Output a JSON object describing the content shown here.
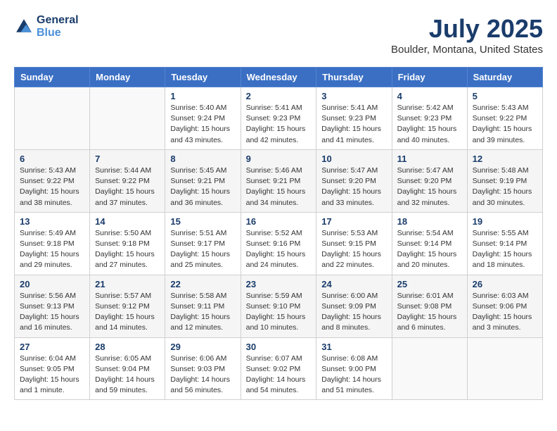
{
  "header": {
    "logo_line1": "General",
    "logo_line2": "Blue",
    "month": "July 2025",
    "location": "Boulder, Montana, United States"
  },
  "weekdays": [
    "Sunday",
    "Monday",
    "Tuesday",
    "Wednesday",
    "Thursday",
    "Friday",
    "Saturday"
  ],
  "weeks": [
    [
      {
        "day": "",
        "sunrise": "",
        "sunset": "",
        "daylight": ""
      },
      {
        "day": "",
        "sunrise": "",
        "sunset": "",
        "daylight": ""
      },
      {
        "day": "1",
        "sunrise": "Sunrise: 5:40 AM",
        "sunset": "Sunset: 9:24 PM",
        "daylight": "Daylight: 15 hours and 43 minutes."
      },
      {
        "day": "2",
        "sunrise": "Sunrise: 5:41 AM",
        "sunset": "Sunset: 9:23 PM",
        "daylight": "Daylight: 15 hours and 42 minutes."
      },
      {
        "day": "3",
        "sunrise": "Sunrise: 5:41 AM",
        "sunset": "Sunset: 9:23 PM",
        "daylight": "Daylight: 15 hours and 41 minutes."
      },
      {
        "day": "4",
        "sunrise": "Sunrise: 5:42 AM",
        "sunset": "Sunset: 9:23 PM",
        "daylight": "Daylight: 15 hours and 40 minutes."
      },
      {
        "day": "5",
        "sunrise": "Sunrise: 5:43 AM",
        "sunset": "Sunset: 9:22 PM",
        "daylight": "Daylight: 15 hours and 39 minutes."
      }
    ],
    [
      {
        "day": "6",
        "sunrise": "Sunrise: 5:43 AM",
        "sunset": "Sunset: 9:22 PM",
        "daylight": "Daylight: 15 hours and 38 minutes."
      },
      {
        "day": "7",
        "sunrise": "Sunrise: 5:44 AM",
        "sunset": "Sunset: 9:22 PM",
        "daylight": "Daylight: 15 hours and 37 minutes."
      },
      {
        "day": "8",
        "sunrise": "Sunrise: 5:45 AM",
        "sunset": "Sunset: 9:21 PM",
        "daylight": "Daylight: 15 hours and 36 minutes."
      },
      {
        "day": "9",
        "sunrise": "Sunrise: 5:46 AM",
        "sunset": "Sunset: 9:21 PM",
        "daylight": "Daylight: 15 hours and 34 minutes."
      },
      {
        "day": "10",
        "sunrise": "Sunrise: 5:47 AM",
        "sunset": "Sunset: 9:20 PM",
        "daylight": "Daylight: 15 hours and 33 minutes."
      },
      {
        "day": "11",
        "sunrise": "Sunrise: 5:47 AM",
        "sunset": "Sunset: 9:20 PM",
        "daylight": "Daylight: 15 hours and 32 minutes."
      },
      {
        "day": "12",
        "sunrise": "Sunrise: 5:48 AM",
        "sunset": "Sunset: 9:19 PM",
        "daylight": "Daylight: 15 hours and 30 minutes."
      }
    ],
    [
      {
        "day": "13",
        "sunrise": "Sunrise: 5:49 AM",
        "sunset": "Sunset: 9:18 PM",
        "daylight": "Daylight: 15 hours and 29 minutes."
      },
      {
        "day": "14",
        "sunrise": "Sunrise: 5:50 AM",
        "sunset": "Sunset: 9:18 PM",
        "daylight": "Daylight: 15 hours and 27 minutes."
      },
      {
        "day": "15",
        "sunrise": "Sunrise: 5:51 AM",
        "sunset": "Sunset: 9:17 PM",
        "daylight": "Daylight: 15 hours and 25 minutes."
      },
      {
        "day": "16",
        "sunrise": "Sunrise: 5:52 AM",
        "sunset": "Sunset: 9:16 PM",
        "daylight": "Daylight: 15 hours and 24 minutes."
      },
      {
        "day": "17",
        "sunrise": "Sunrise: 5:53 AM",
        "sunset": "Sunset: 9:15 PM",
        "daylight": "Daylight: 15 hours and 22 minutes."
      },
      {
        "day": "18",
        "sunrise": "Sunrise: 5:54 AM",
        "sunset": "Sunset: 9:14 PM",
        "daylight": "Daylight: 15 hours and 20 minutes."
      },
      {
        "day": "19",
        "sunrise": "Sunrise: 5:55 AM",
        "sunset": "Sunset: 9:14 PM",
        "daylight": "Daylight: 15 hours and 18 minutes."
      }
    ],
    [
      {
        "day": "20",
        "sunrise": "Sunrise: 5:56 AM",
        "sunset": "Sunset: 9:13 PM",
        "daylight": "Daylight: 15 hours and 16 minutes."
      },
      {
        "day": "21",
        "sunrise": "Sunrise: 5:57 AM",
        "sunset": "Sunset: 9:12 PM",
        "daylight": "Daylight: 15 hours and 14 minutes."
      },
      {
        "day": "22",
        "sunrise": "Sunrise: 5:58 AM",
        "sunset": "Sunset: 9:11 PM",
        "daylight": "Daylight: 15 hours and 12 minutes."
      },
      {
        "day": "23",
        "sunrise": "Sunrise: 5:59 AM",
        "sunset": "Sunset: 9:10 PM",
        "daylight": "Daylight: 15 hours and 10 minutes."
      },
      {
        "day": "24",
        "sunrise": "Sunrise: 6:00 AM",
        "sunset": "Sunset: 9:09 PM",
        "daylight": "Daylight: 15 hours and 8 minutes."
      },
      {
        "day": "25",
        "sunrise": "Sunrise: 6:01 AM",
        "sunset": "Sunset: 9:08 PM",
        "daylight": "Daylight: 15 hours and 6 minutes."
      },
      {
        "day": "26",
        "sunrise": "Sunrise: 6:03 AM",
        "sunset": "Sunset: 9:06 PM",
        "daylight": "Daylight: 15 hours and 3 minutes."
      }
    ],
    [
      {
        "day": "27",
        "sunrise": "Sunrise: 6:04 AM",
        "sunset": "Sunset: 9:05 PM",
        "daylight": "Daylight: 15 hours and 1 minute."
      },
      {
        "day": "28",
        "sunrise": "Sunrise: 6:05 AM",
        "sunset": "Sunset: 9:04 PM",
        "daylight": "Daylight: 14 hours and 59 minutes."
      },
      {
        "day": "29",
        "sunrise": "Sunrise: 6:06 AM",
        "sunset": "Sunset: 9:03 PM",
        "daylight": "Daylight: 14 hours and 56 minutes."
      },
      {
        "day": "30",
        "sunrise": "Sunrise: 6:07 AM",
        "sunset": "Sunset: 9:02 PM",
        "daylight": "Daylight: 14 hours and 54 minutes."
      },
      {
        "day": "31",
        "sunrise": "Sunrise: 6:08 AM",
        "sunset": "Sunset: 9:00 PM",
        "daylight": "Daylight: 14 hours and 51 minutes."
      },
      {
        "day": "",
        "sunrise": "",
        "sunset": "",
        "daylight": ""
      },
      {
        "day": "",
        "sunrise": "",
        "sunset": "",
        "daylight": ""
      }
    ]
  ]
}
